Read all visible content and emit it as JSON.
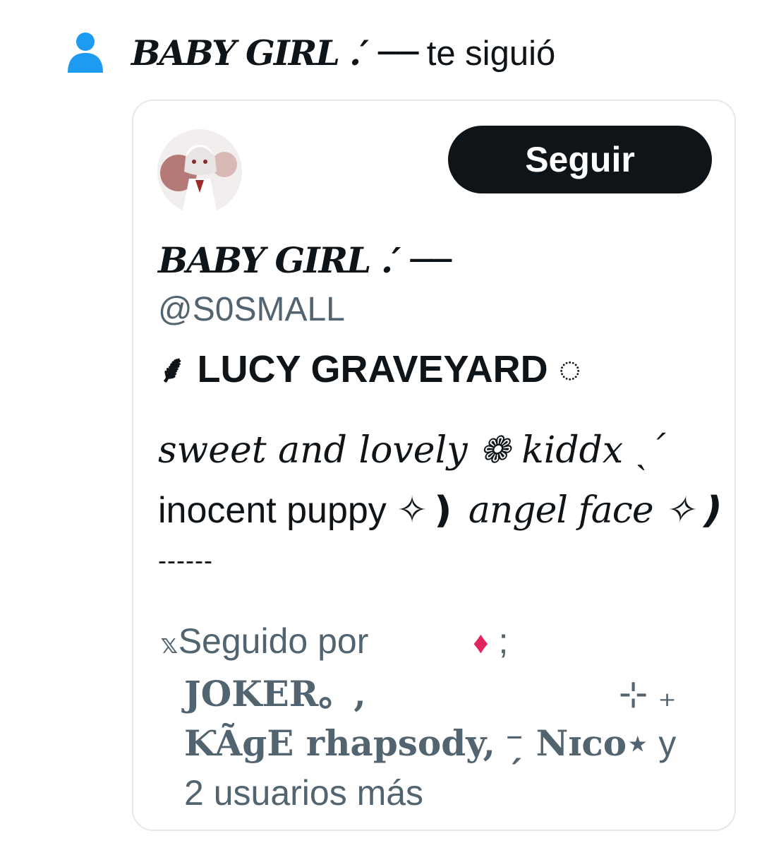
{
  "notification": {
    "icon": "person-icon",
    "accent_color": "#1d9bf0",
    "name": "BABY GIRL .′ ──",
    "action": "te siguió"
  },
  "card": {
    "avatar": "avatar",
    "follow_label": "Seguir",
    "display_name": "BABY GIRL .′ ──",
    "handle": "@S0SMALL",
    "bio_line1": "⸙ LUCY GRAVEYARD ◌",
    "bio_line2": "sweet and lovely  ❁  kiddx ˎˊ",
    "bio_line3_a": "inocent puppy ✧❫ ",
    "bio_line3_b": "angel face ✧❫",
    "bio_line4": "--‐‐--",
    "followed_by": {
      "label": "Seguido por",
      "suffix": "♦ ;",
      "follower1": "JOKER。,",
      "deco1": "⊹ ₊",
      "follower2": "ƘÃɡE rhapsody,",
      "follower3": "⁻̗ Nɪᴄᴏ⋆",
      "conjunction": "y",
      "more": "2 usuarios más"
    }
  }
}
